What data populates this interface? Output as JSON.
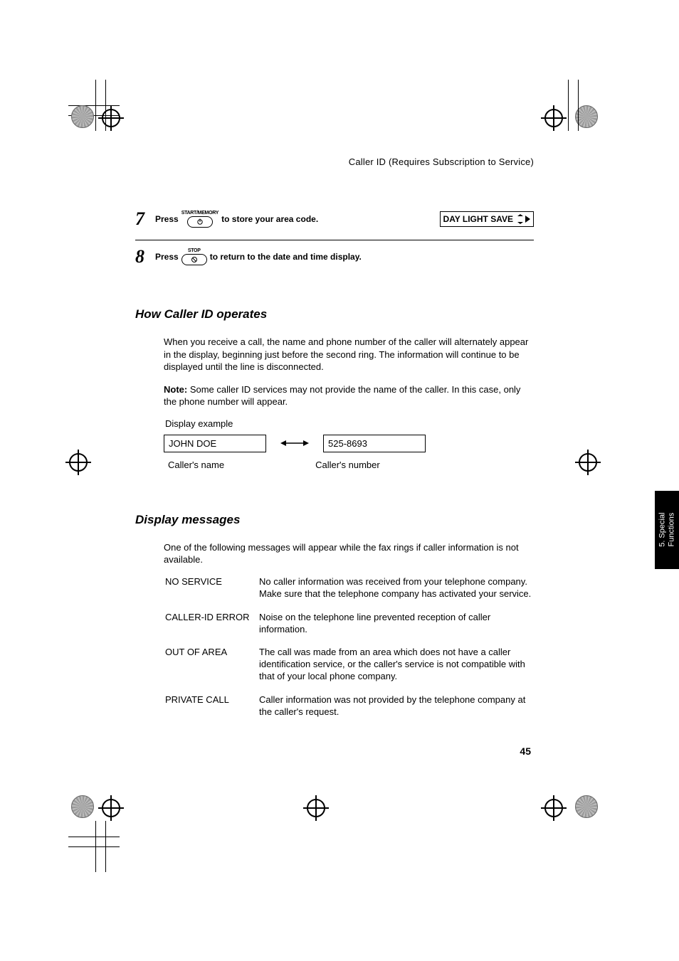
{
  "header": "Caller ID (Requires Subscription to Service)",
  "steps": [
    {
      "num": "7",
      "pre": "Press",
      "key_label": "START/MEMORY",
      "post": " to store your area code.",
      "lcd": "DAY LIGHT SAVE"
    },
    {
      "num": "8",
      "pre": "Press",
      "key_label": "STOP",
      "post": " to return to the date and time display."
    }
  ],
  "section1": {
    "title": "How Caller ID operates",
    "p1": "When you receive a call, the name and phone number of the caller will alternately appear in the display, beginning just before the second ring. The information will continue to be displayed until the line is disconnected.",
    "note_label": "Note:",
    "note": " Some caller ID services may not provide the name of the caller. In this case, only the phone number will appear.",
    "example_label": "Display example",
    "example_name": "JOHN DOE",
    "example_number": "525-8693",
    "caption_name": "Caller's name",
    "caption_number": "Caller's number"
  },
  "section2": {
    "title": "Display messages",
    "intro": "One of the following messages will appear while the fax rings if caller information is not available.",
    "rows": [
      {
        "label": "NO SERVICE",
        "desc": "No caller information was received from your telephone company. Make sure that the telephone company has activated your service."
      },
      {
        "label": "CALLER-ID ERROR",
        "desc": "Noise on the telephone line prevented reception of caller information."
      },
      {
        "label": "OUT OF AREA",
        "desc": "The call was made from an area which does not have a caller identification service, or the caller's service is not compatible with that of your local phone company."
      },
      {
        "label": "PRIVATE CALL",
        "desc": "Caller information was not provided by the telephone company at the caller's request."
      }
    ]
  },
  "side_tab": "5. Special\nFunctions",
  "page_number": "45"
}
